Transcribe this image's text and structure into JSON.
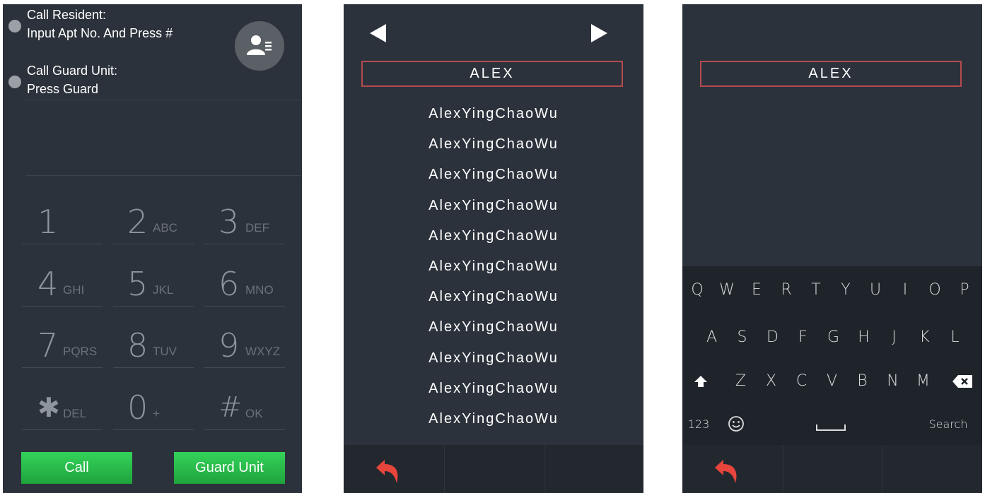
{
  "dial_screen": {
    "instruction_resident_title": "Call Resident:",
    "instruction_resident_text": "Input Apt No. And Press #",
    "instruction_guard_title": "Call Guard Unit:",
    "instruction_guard_text": "Press Guard",
    "contact_icon": "contact-list-icon",
    "keys": [
      {
        "main": "1",
        "sub": ""
      },
      {
        "main": "2",
        "sub": "ABC"
      },
      {
        "main": "3",
        "sub": "DEF"
      },
      {
        "main": "4",
        "sub": "GHI"
      },
      {
        "main": "5",
        "sub": "JKL"
      },
      {
        "main": "6",
        "sub": "MNO"
      },
      {
        "main": "7",
        "sub": "PQRS"
      },
      {
        "main": "8",
        "sub": "TUV"
      },
      {
        "main": "9",
        "sub": "WXYZ"
      },
      {
        "main": "✱",
        "sub": "DEL"
      },
      {
        "main": "0",
        "sub": "+"
      },
      {
        "main": "#",
        "sub": "OK"
      }
    ],
    "call_label": "Call",
    "guard_unit_label": "Guard Unit",
    "button_color": "#22b444"
  },
  "directory_screen": {
    "search_value": "ALEX",
    "names": [
      "AlexYingChaoWu",
      "AlexYingChaoWu",
      "AlexYingChaoWu",
      "AlexYingChaoWu",
      "AlexYingChaoWu",
      "AlexYingChaoWu",
      "AlexYingChaoWu",
      "AlexYingChaoWu",
      "AlexYingChaoWu",
      "AlexYingChaoWu",
      "AlexYingChaoWu"
    ],
    "prev_icon": "triangle-left-icon",
    "next_icon": "triangle-right-icon",
    "back_icon": "back-arrow-icon",
    "back_color": "#e8453c"
  },
  "keyboard_screen": {
    "search_value": "ALEX",
    "row1": [
      "Q",
      "W",
      "E",
      "R",
      "T",
      "Y",
      "U",
      "I",
      "O",
      "P"
    ],
    "row2": [
      "A",
      "S",
      "D",
      "F",
      "G",
      "H",
      "J",
      "K",
      "L"
    ],
    "row3": [
      "Z",
      "X",
      "C",
      "V",
      "B",
      "N",
      "M"
    ],
    "numbers_label": "123",
    "search_label": "Search",
    "shift_icon": "shift-arrow-icon",
    "backspace_icon": "backspace-icon",
    "emoji_icon": "emoji-icon",
    "space_icon": "space-bar-icon",
    "back_icon": "back-arrow-icon"
  }
}
